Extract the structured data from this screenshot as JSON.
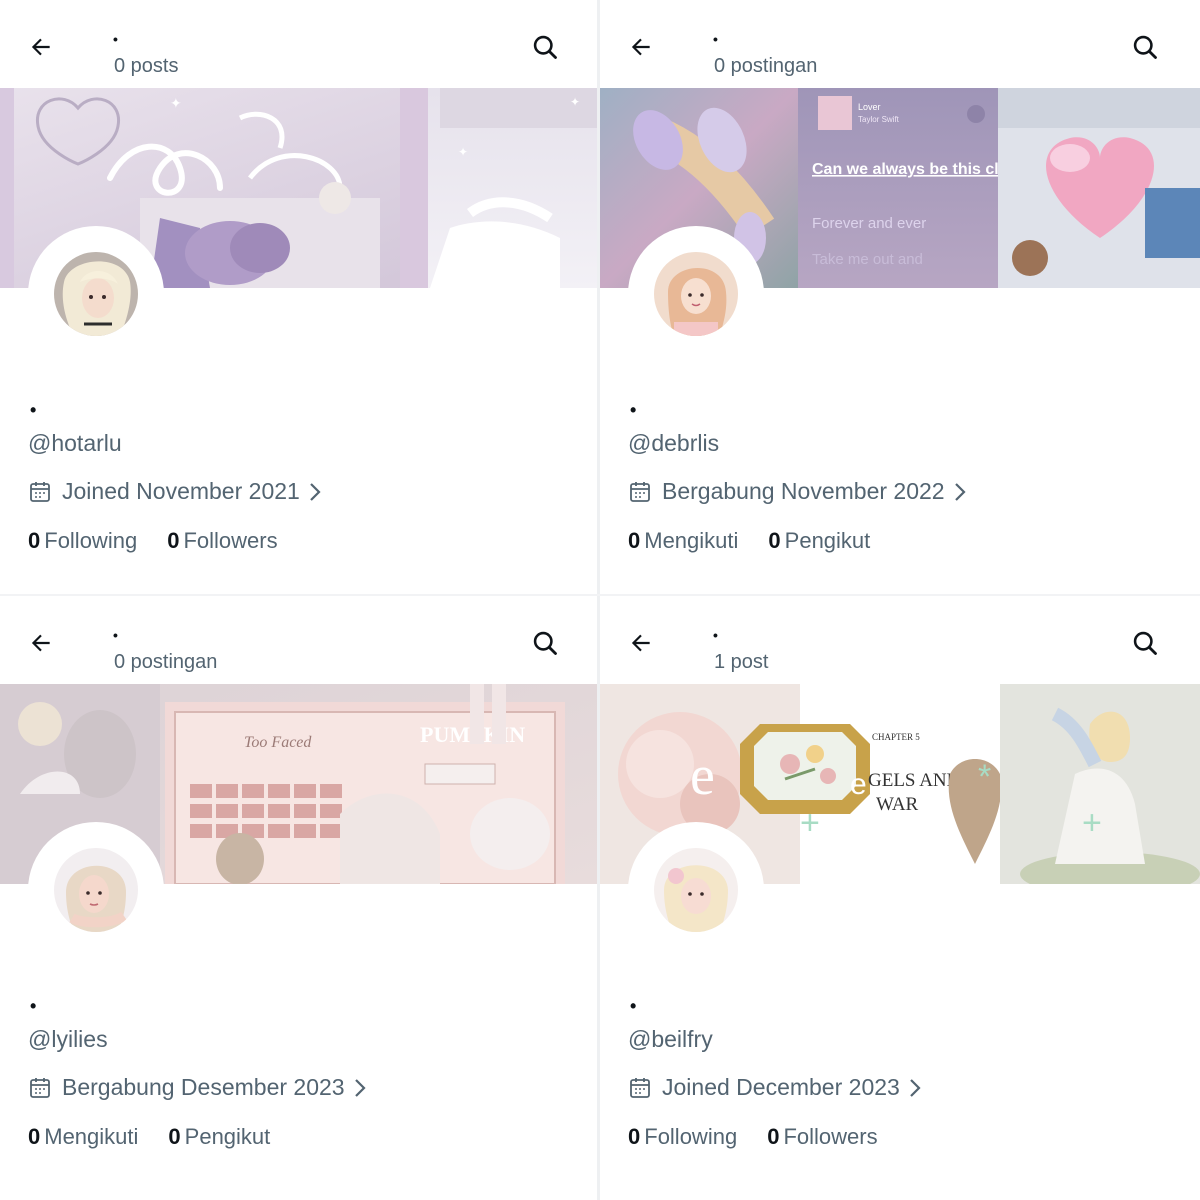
{
  "profiles": [
    {
      "name": "•",
      "post_count": "0 posts",
      "handle": "@hotarlu",
      "joined": "Joined November 2021",
      "following_count": "0",
      "following_label": "Following",
      "followers_count": "0",
      "followers_label": "Followers"
    },
    {
      "name": "•",
      "post_count": "0 postingan",
      "handle": "@debrlis",
      "joined": "Bergabung November 2022",
      "following_count": "0",
      "following_label": "Mengikuti",
      "followers_count": "0",
      "followers_label": "Pengikut",
      "banner_text": {
        "song_title": "Lover",
        "song_artist": "Taylor Swift",
        "lyric_1": "Can we always be this close?",
        "lyric_2": "Forever and ever",
        "lyric_3": "Take me out and"
      }
    },
    {
      "name": "•",
      "post_count": "0 postingan",
      "handle": "@lyilies",
      "joined": "Bergabung Desember 2023",
      "following_count": "0",
      "following_label": "Mengikuti",
      "followers_count": "0",
      "followers_label": "Pengikut",
      "banner_text": {
        "brand": "Too Faced",
        "product": "PUMPKIN"
      }
    },
    {
      "name": "•",
      "post_count": "1 post",
      "handle": "@beilfry",
      "joined": "Joined December 2023",
      "following_count": "0",
      "following_label": "Following",
      "followers_count": "0",
      "followers_label": "Followers",
      "banner_text": {
        "chapter": "CHAPTER 5",
        "title_1": "GELS AND",
        "title_2": "WAR"
      }
    }
  ],
  "icons": {
    "back": "arrow-left-icon",
    "search": "search-icon",
    "calendar": "calendar-icon",
    "chevron": "chevron-right-icon"
  },
  "colors": {
    "text": "#0f1419",
    "secondary": "#536471"
  }
}
